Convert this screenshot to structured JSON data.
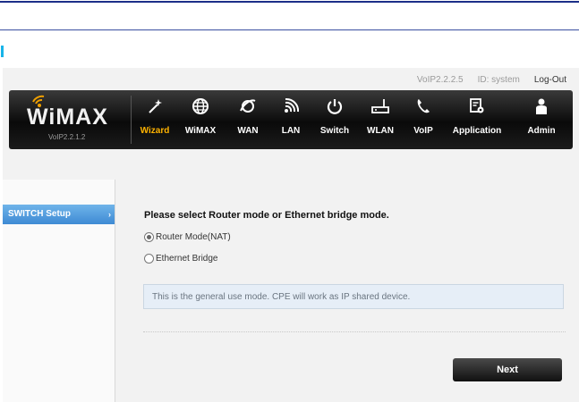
{
  "header": {
    "firmware_version": "VoIP2.2.2.5",
    "user_id": "ID: system",
    "logout_label": "Log-Out"
  },
  "brand": {
    "logo_text": "WiMAX",
    "logo_version": "VoIP2.2.1.2"
  },
  "nav": {
    "items": [
      {
        "label": "Wizard",
        "icon": "magic-wand-icon",
        "active": true
      },
      {
        "label": "WiMAX",
        "icon": "globe-icon"
      },
      {
        "label": "WAN",
        "icon": "wan-globe-icon"
      },
      {
        "label": "LAN",
        "icon": "signal-waves-icon"
      },
      {
        "label": "Switch",
        "icon": "power-icon"
      },
      {
        "label": "WLAN",
        "icon": "router-icon"
      },
      {
        "label": "VoIP",
        "icon": "phone-icon"
      },
      {
        "label": "Application",
        "icon": "document-gear-icon"
      },
      {
        "label": "Admin",
        "icon": "person-icon"
      }
    ]
  },
  "sidebar": {
    "items": [
      {
        "label": "SWITCH Setup",
        "active": true
      }
    ]
  },
  "main": {
    "question": "Please select Router mode or Ethernet bridge mode.",
    "options": [
      {
        "label": "Router Mode(NAT)",
        "checked": true
      },
      {
        "label": "Ethernet Bridge",
        "checked": false
      }
    ],
    "info_text": "This is the general use mode. CPE will work as IP shared device.",
    "next_label": "Next"
  },
  "colors": {
    "active_nav": "#ffb300",
    "sidebar_active": "#4f9be0",
    "info_bg": "#e6eef7"
  }
}
